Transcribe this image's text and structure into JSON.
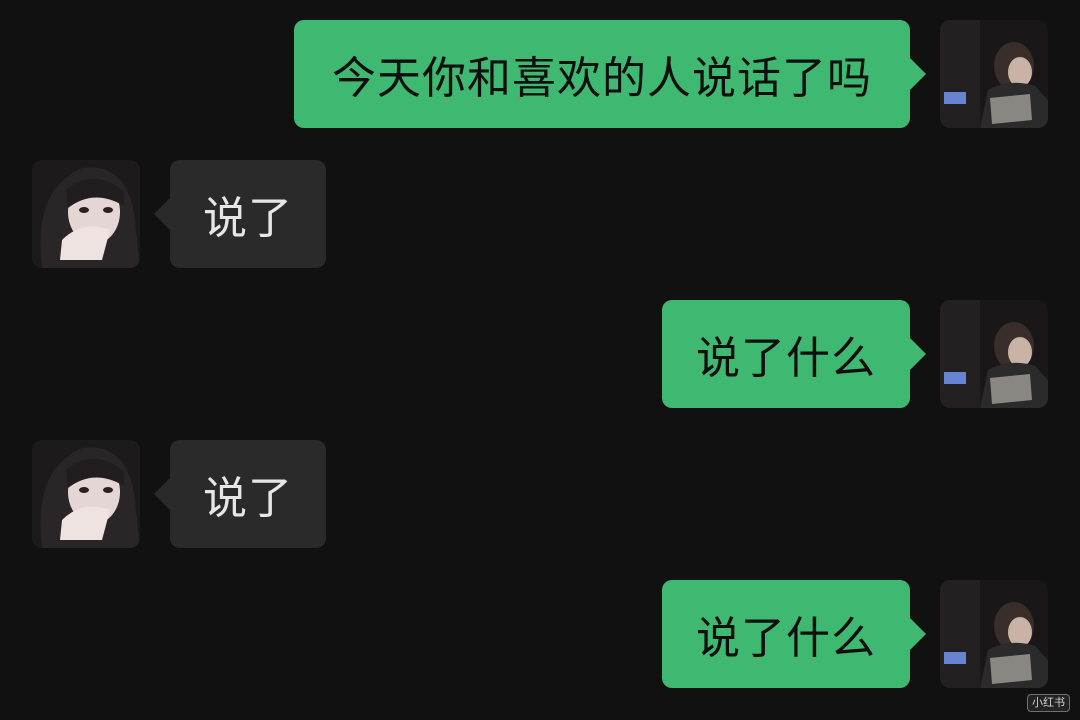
{
  "messages": [
    {
      "side": "outgoing",
      "text": "今天你和喜欢的人说话了吗",
      "avatar": "boy-avatar"
    },
    {
      "side": "incoming",
      "text": "说了",
      "avatar": "girl-avatar"
    },
    {
      "side": "outgoing",
      "text": "说了什么",
      "avatar": "boy-avatar"
    },
    {
      "side": "incoming",
      "text": "说了",
      "avatar": "girl-avatar"
    },
    {
      "side": "outgoing",
      "text": "说了什么",
      "avatar": "boy-avatar"
    }
  ],
  "watermark": "小红书",
  "colors": {
    "background": "#111111",
    "outgoing_bubble": "#3fb871",
    "incoming_bubble": "#2a2a2a"
  }
}
